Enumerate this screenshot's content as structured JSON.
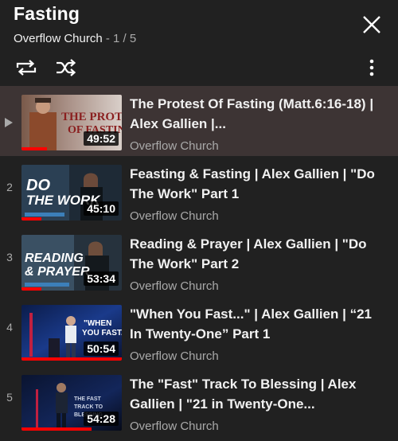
{
  "playlist": {
    "title": "Fasting",
    "owner": "Overflow Church",
    "position": "- 1 / 5"
  },
  "icons": {
    "close": "close-icon",
    "loop": "loop-icon",
    "shuffle": "shuffle-icon",
    "more": "more-vert-icon"
  },
  "colors": {
    "background": "#212121",
    "active_row": "#3d3434",
    "progress": "#ff0000"
  },
  "videos": [
    {
      "index": "",
      "playing": true,
      "title": "The Protest Of Fasting (Matt.6:16-18) | Alex Gallien |...",
      "channel": "Overflow Church",
      "duration": "49:52",
      "thumb_text": "PROTEST OF FASTING",
      "watched_fraction": 0.25
    },
    {
      "index": "2",
      "playing": false,
      "title": "Feasting & Fasting | Alex Gallien | \"Do The Work\" Part 1",
      "channel": "Overflow Church",
      "duration": "45:10",
      "thumb_text": "DO THE WORK",
      "watched_fraction": 0.2
    },
    {
      "index": "3",
      "playing": false,
      "title": "Reading & Prayer | Alex Gallien | \"Do The Work\" Part 2",
      "channel": "Overflow Church",
      "duration": "53:34",
      "thumb_text": "READING & PRAYER",
      "watched_fraction": 0.2
    },
    {
      "index": "4",
      "playing": false,
      "title": "\"When You Fast...\" | Alex Gallien | “21 In Twenty-One” Part 1",
      "channel": "Overflow Church",
      "duration": "50:54",
      "thumb_text": "\"WHEN YOU FAST...\"",
      "watched_fraction": 1.0
    },
    {
      "index": "5",
      "playing": false,
      "title": "The \"Fast\" Track To Blessing | Alex Gallien | \"21 in Twenty-One...",
      "channel": "Overflow Church",
      "duration": "54:28",
      "thumb_text": "FAST TRACK TO BLESSING",
      "watched_fraction": 0.7
    }
  ]
}
